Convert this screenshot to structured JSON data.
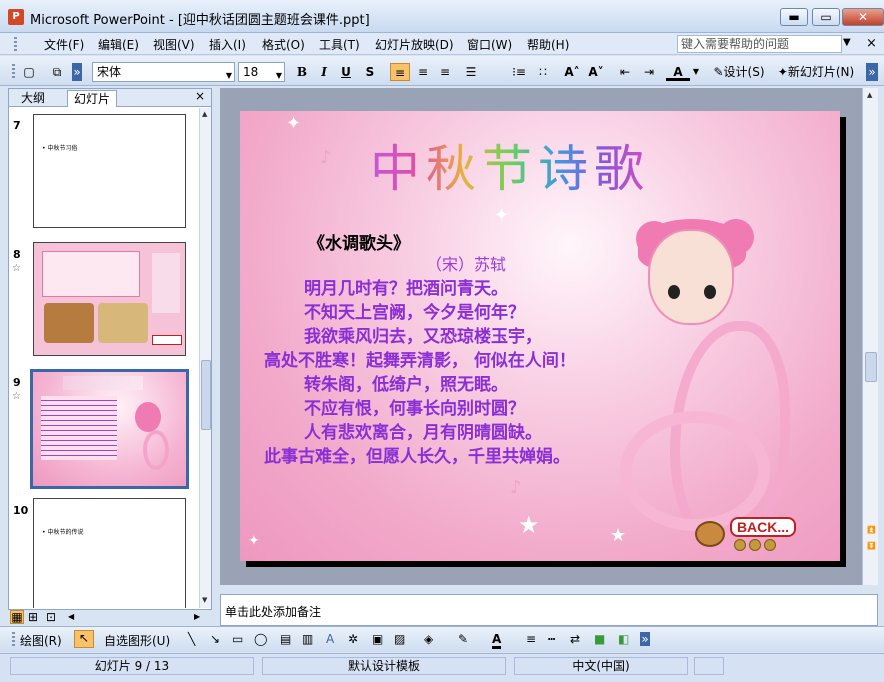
{
  "window": {
    "title": "Microsoft PowerPoint - [迎中秋话团圆主题班会课件.ppt]",
    "minimize": "▬",
    "restore": "▭",
    "close": "✕"
  },
  "menu": {
    "items": [
      "文件(F)",
      "编辑(E)",
      "视图(V)",
      "插入(I)",
      "格式(O)",
      "工具(T)",
      "幻灯片放映(D)",
      "窗口(W)",
      "帮助(H)"
    ],
    "help_placeholder": "键入需要帮助的问题"
  },
  "toolbar": {
    "font_name": "宋体",
    "font_size": "18",
    "bold": "B",
    "italic": "I",
    "underline": "U",
    "shadow": "S",
    "design_label": "设计(S)",
    "new_slide_label": "新幻灯片(N)"
  },
  "left_pane": {
    "tabs": [
      "大纲",
      "幻灯片"
    ],
    "close": "×",
    "slides": [
      {
        "number": "7",
        "bullet": "• 中秋节习俗"
      },
      {
        "number": "8",
        "bullet": ""
      },
      {
        "number": "9",
        "bullet": ""
      },
      {
        "number": "10",
        "bullet": "• 中秋节的传说"
      }
    ]
  },
  "slide": {
    "title": "中秋节诗歌",
    "poem_heading": "《水调歌头》",
    "poem_author": "（宋）苏轼",
    "lines": [
      "明月几时有？把酒问青天。",
      "不知天上宫阙，今夕是何年？",
      "我欲乘风归去，又恐琼楼玉宇，",
      "高处不胜寒！起舞弄清影， 何似在人间！",
      "转朱阁，低绮户，照无眠。",
      "不应有恨，何事长向别时圆？",
      "人有悲欢离合，月有阴晴圆缺。",
      "此事古难全，但愿人长久，千里共婵娟。"
    ],
    "back_button": "BACK..."
  },
  "notes": {
    "placeholder": "单击此处添加备注"
  },
  "draw_toolbar": {
    "draw_label": "绘图(R)",
    "autoshapes_label": "自选图形(U)"
  },
  "status": {
    "slide_indicator": "幻灯片 9 / 13",
    "template": "默认设计模板",
    "language": "中文(中国)"
  }
}
